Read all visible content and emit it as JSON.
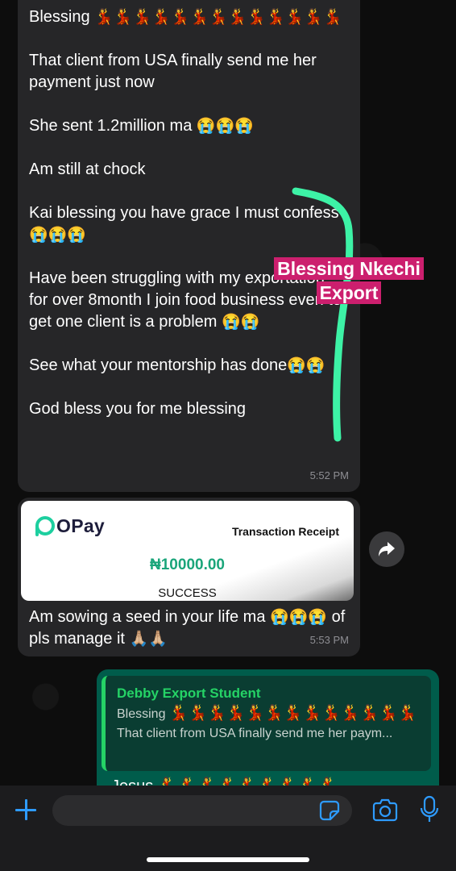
{
  "message1": {
    "text_first": "Blessing ",
    "first_emojis": "💃💃💃💃💃💃💃💃💃💃💃💃💃",
    "para_1": "That client from USA finally send me her payment just now",
    "para_2_text": "She sent 1.2million ma ",
    "para_2_emojis": "😭😭😭",
    "para_3": "Am still at chock",
    "para_4_text": "Kai blessing you have grace I must confess ",
    "para_4_emojis": "😭😭😭",
    "para_5_text": "Have been struggling with my exportation for over 8month I join food business even to get one client is a problem ",
    "para_5_emojis": "😭😭",
    "para_6_text": "See what your mentorship has done",
    "para_6_emojis": "😭😭",
    "para_7": "God bless you for me blessing",
    "time": "5:52 PM"
  },
  "message2": {
    "receipt": {
      "brand": "OPay",
      "title": "Transaction Receipt",
      "amount": "₦10000.00",
      "status": "SUCCESS"
    },
    "text_a": "Am sowing a seed in your life ma ",
    "emojis_a": "😭😭😭",
    "text_b": " of pls manage it ",
    "emojis_b": "🙏🏼🙏🏼",
    "time": "5:53 PM"
  },
  "message3": {
    "quote_author": "Debby  Export Student",
    "quote_line1_text": "Blessing ",
    "quote_line1_emojis": "💃💃💃💃💃💃💃💃💃💃💃💃💃",
    "quote_line2": "That client from USA finally send me her paym...",
    "text": "Jesus 💃💃💃💃💃💃💃💃💃"
  },
  "annotation": {
    "label": "Blessing Nkechi Export",
    "color": "#cc1f6e",
    "stroke_color": "#3df2a6"
  },
  "composer": {
    "placeholder": ""
  },
  "colors": {
    "incoming_bubble": "#262628",
    "outgoing_bubble": "#005c4b",
    "accent_blue": "#2e9bff",
    "opay_green": "#1dcf9f"
  },
  "icons": [
    "forward-icon",
    "plus-icon",
    "sticker-icon",
    "camera-icon",
    "microphone-icon"
  ]
}
